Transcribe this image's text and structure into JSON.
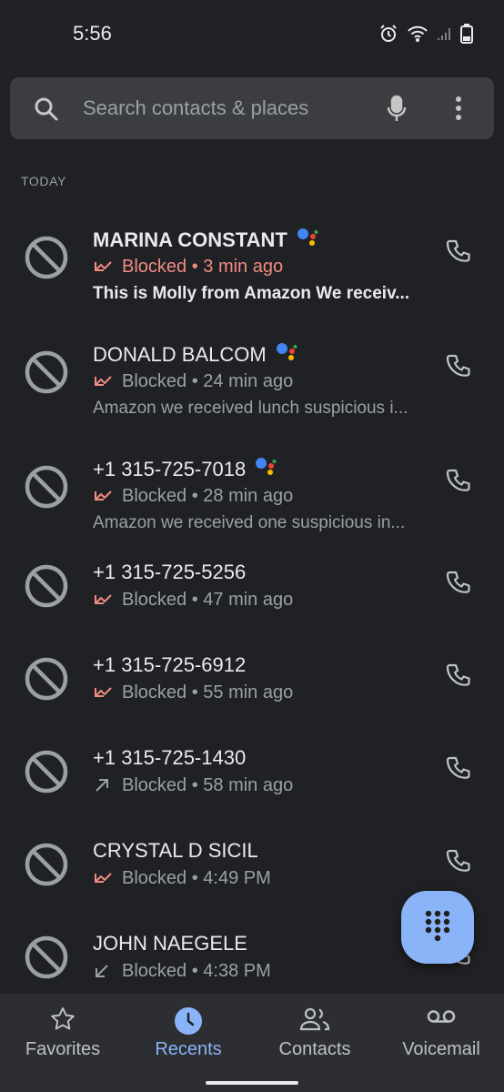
{
  "status_bar": {
    "time": "5:56"
  },
  "search": {
    "placeholder": "Search contacts & places"
  },
  "section": {
    "today": "TODAY"
  },
  "calls": [
    {
      "name": "MARINA CONSTANT",
      "status": "Blocked • 3 min ago",
      "transcript": "This is Molly from Amazon We receiv...",
      "assistant": true,
      "unread": true,
      "type": "blocked"
    },
    {
      "name": "DONALD BALCOM",
      "status": "Blocked • 24 min ago",
      "transcript": "Amazon we received lunch suspicious i...",
      "assistant": true,
      "unread": false,
      "type": "blocked"
    },
    {
      "name": "+1 315-725-7018",
      "status": "Blocked • 28 min ago",
      "transcript": "Amazon we received one suspicious in...",
      "assistant": true,
      "unread": false,
      "type": "blocked"
    },
    {
      "name": "+1 315-725-5256",
      "status": "Blocked • 47 min ago",
      "transcript": "",
      "assistant": false,
      "unread": false,
      "type": "blocked"
    },
    {
      "name": "+1 315-725-6912",
      "status": "Blocked • 55 min ago",
      "transcript": "",
      "assistant": false,
      "unread": false,
      "type": "blocked"
    },
    {
      "name": "+1 315-725-1430",
      "status": "Blocked • 58 min ago",
      "transcript": "",
      "assistant": false,
      "unread": false,
      "type": "outgoing"
    },
    {
      "name": "CRYSTAL D SICIL",
      "status": "Blocked • 4:49 PM",
      "transcript": "",
      "assistant": false,
      "unread": false,
      "type": "blocked"
    },
    {
      "name": "JOHN NAEGELE",
      "status": "Blocked • 4:38 PM",
      "transcript": "",
      "assistant": false,
      "unread": false,
      "type": "incoming"
    }
  ],
  "bottom_nav": {
    "favorites": "Favorites",
    "recents": "Recents",
    "contacts": "Contacts",
    "voicemail": "Voicemail",
    "active": "recents"
  },
  "icons": {
    "search": "search-icon",
    "mic": "mic-icon",
    "more": "more-vert-icon",
    "blocked": "blocked-icon",
    "phone": "phone-icon",
    "assistant": "google-assistant-icon",
    "dialpad": "dialpad-icon",
    "favorites": "star-icon",
    "recents": "clock-icon",
    "contacts": "people-icon",
    "voicemail": "voicemail-icon"
  },
  "colors": {
    "background": "#202124",
    "accent": "#8ab4f8",
    "missed": "#f28b82",
    "text_primary": "#e8eaed",
    "text_secondary": "#9aa0a6"
  }
}
